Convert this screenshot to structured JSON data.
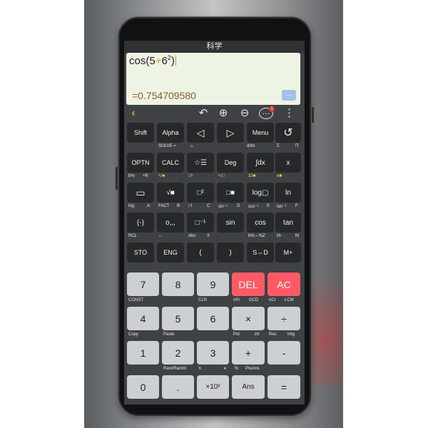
{
  "titlebar": {
    "title": "科学"
  },
  "display": {
    "expression_prefix": "cos(5",
    "expression_plus": "+",
    "expression_base": "6",
    "expression_exponent": "2",
    "expression_suffix": ")",
    "result": "=0.754709580",
    "more_label": "..."
  },
  "toolbar": {
    "back_icon": "‹",
    "undo_icon": "↶",
    "zoom_in_icon": "⊕",
    "zoom_out_icon": "⊖",
    "chat_icon": "…",
    "chat_badge": "1",
    "menu_icon": "⋮"
  },
  "keys": {
    "shift": "Shift",
    "alpha": "Alpha",
    "left": "◁",
    "right": "▷",
    "menu": "Menu",
    "history": "↺",
    "optn": "OPTN",
    "calc": "CALC",
    "stats": "☆☰",
    "deg": "Deg",
    "integral": "∫dx",
    "x": "x",
    "fraction": "▭",
    "sqrt": "√■",
    "square": "□²",
    "power": "□■",
    "log": "log▢",
    "ln": "ln",
    "neg": "(-)",
    "degmin": "o,,,",
    "inverse": "□⁻¹",
    "sin": "sin",
    "cos": "cos",
    "tan": "tan",
    "sto": "STO",
    "eng": "ENG",
    "lparen": "(",
    "rparen": ")",
    "sd": "S⇔D",
    "mplus": "M+",
    "n7": "7",
    "n8": "8",
    "n9": "9",
    "del": "DEL",
    "ac": "AC",
    "n4": "4",
    "n5": "5",
    "n6": "6",
    "mul": "×",
    "div": "÷",
    "n1": "1",
    "n2": "2",
    "n3": "3",
    "add": "+",
    "sub": "-",
    "n0": "0",
    "dot": ".",
    "exp10": "×10ˣ",
    "ans": "Ans",
    "eq": "="
  },
  "labels": {
    "solve": "SOLVE =",
    "star1": "☆",
    "ddx": "d/dx",
    "sigma": "Σ",
    "pi": "Π",
    "bpct": "b%",
    "pr": "÷R",
    "sqrt3": "³√■",
    "cube": "□³",
    "rootx": "ˣ√□",
    "e10": "10■",
    "ex": "e■",
    "log": "log",
    "a": "A",
    "fact": "FACT",
    "b": "B",
    "inv": "□!",
    "c": "C",
    "sin1": "sin⁻¹",
    "d": "D",
    "cos1": "cos⁻¹",
    "e": "E",
    "tan1": "tan⁻¹",
    "f": "F",
    "rcl": "RCL",
    "arrow": "←",
    "abs": "Abs",
    "xv": "X",
    "conv": "b%⇔%Z",
    "mminus": "M-",
    "m": "M",
    "const": "CONST",
    "clr": "CLR",
    "npr": "nPr",
    "gcd": "GCD",
    "ncr": "nCr",
    "lcm": "LCM",
    "copy": "Copy",
    "paste": "Paste",
    "pol": "Pol",
    "int": "int",
    "rec": "Rec",
    "intg": "Intg",
    "ranrn": "Ran#RanInt",
    "pi2": "π",
    "e2": "e",
    "pct": "%",
    "preans": "PreAns"
  },
  "colors": {
    "accent": "#e89a2a",
    "red_key": "#ff5a64",
    "num_key": "#cdd0d2",
    "sci_key": "#262829",
    "display_bg": "#edf4e4",
    "result_text": "#8c5a2b",
    "label_yellow": "#f2d35a"
  }
}
